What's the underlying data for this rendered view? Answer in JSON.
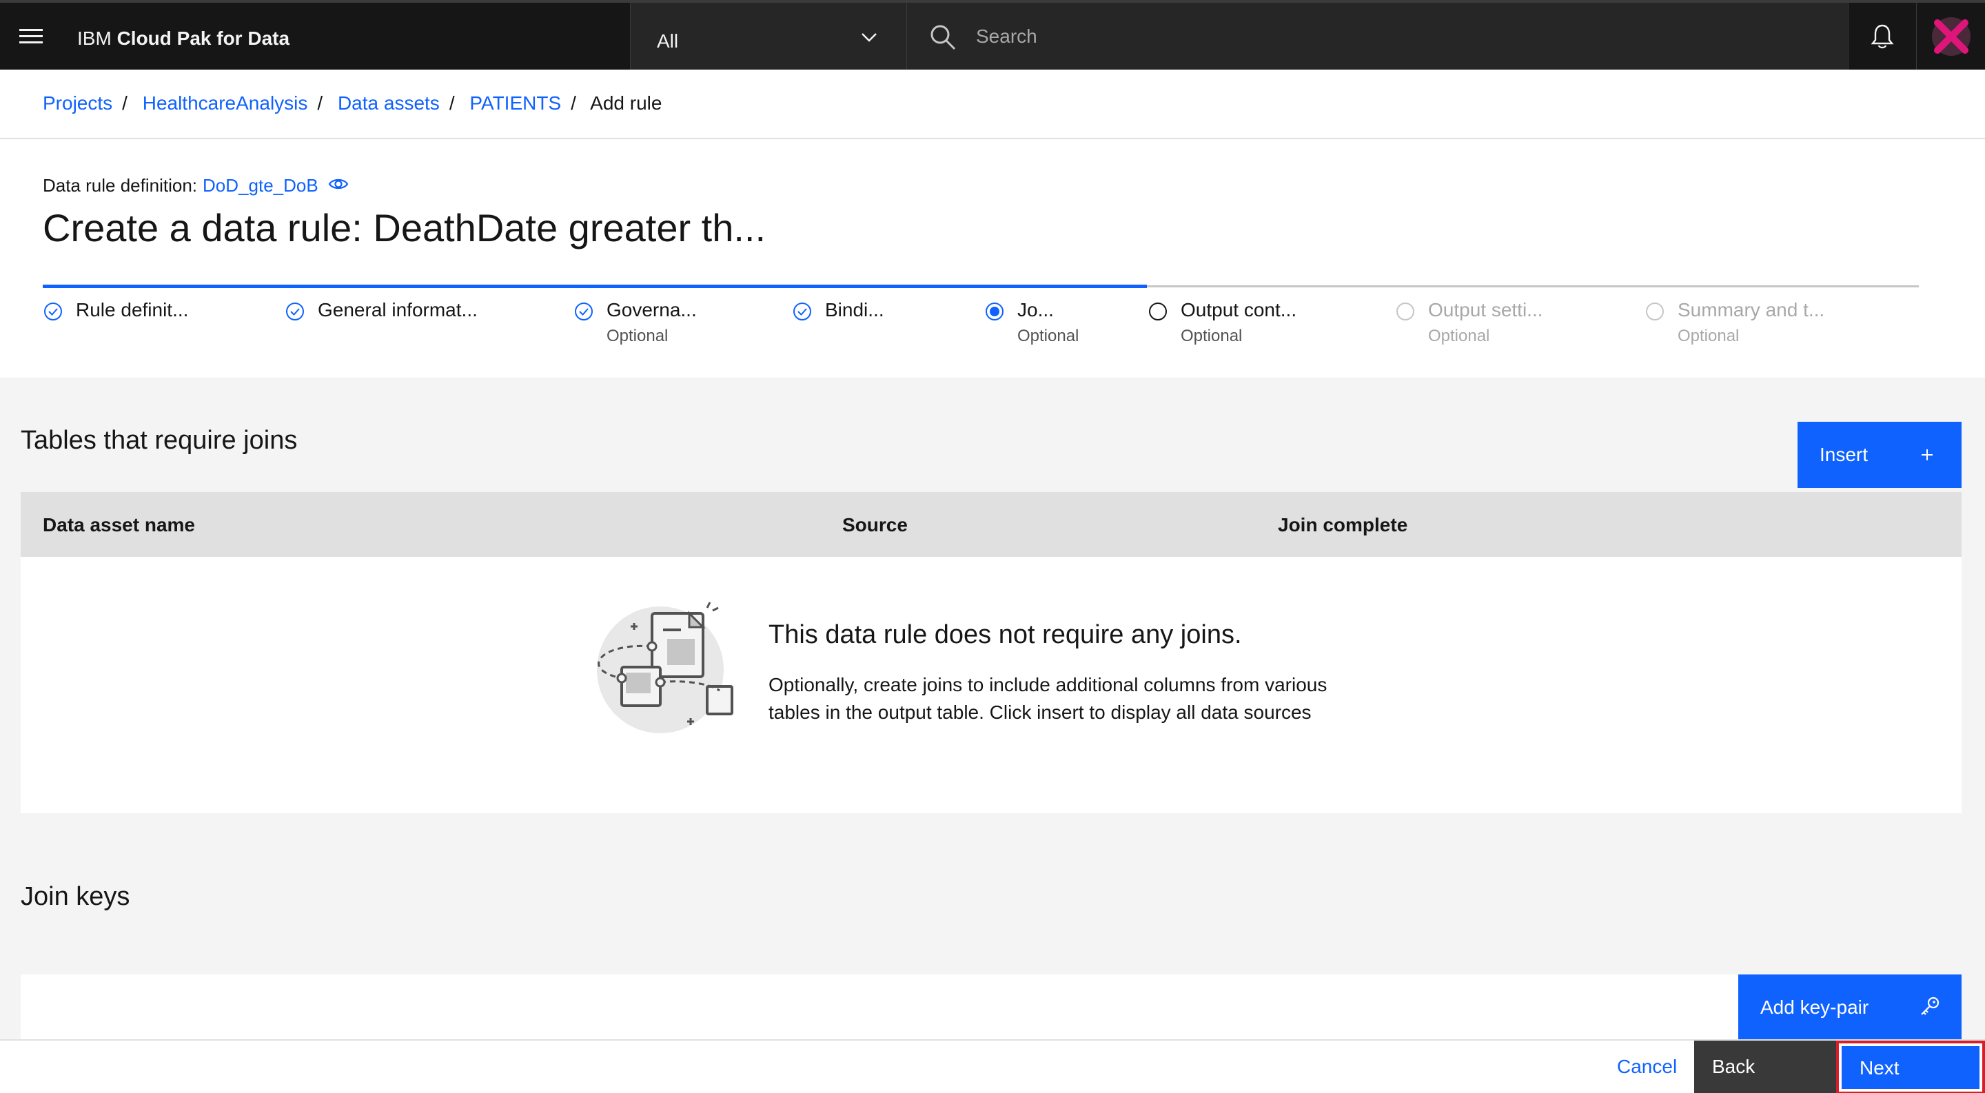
{
  "header": {
    "brand_prefix": "IBM",
    "brand_name": "Cloud Pak for Data",
    "scope_selected": "All",
    "search_placeholder": "Search"
  },
  "breadcrumb": {
    "items": [
      "Projects",
      "HealthcareAnalysis",
      "Data assets",
      "PATIENTS"
    ],
    "current": "Add rule",
    "separator": "/"
  },
  "definition": {
    "label": "Data rule definition:",
    "value": "DoD_gte_DoB"
  },
  "page_title": "Create a data rule: DeathDate greater th...",
  "steps": [
    {
      "label": "Rule definit...",
      "optional": "",
      "state": "complete"
    },
    {
      "label": "General informat...",
      "optional": "",
      "state": "complete"
    },
    {
      "label": "Governa...",
      "optional": "Optional",
      "state": "complete"
    },
    {
      "label": "Bindi...",
      "optional": "",
      "state": "complete"
    },
    {
      "label": "Jo...",
      "optional": "Optional",
      "state": "current"
    },
    {
      "label": "Output cont...",
      "optional": "Optional",
      "state": "incomplete"
    },
    {
      "label": "Output setti...",
      "optional": "Optional",
      "state": "disabled"
    },
    {
      "label": "Summary and t...",
      "optional": "Optional",
      "state": "disabled"
    }
  ],
  "joins": {
    "title": "Tables that require joins",
    "insert_label": "Insert",
    "columns": [
      "Data asset name",
      "Source",
      "Join complete"
    ],
    "empty_title": "This data rule does not require any joins.",
    "empty_desc": "Optionally, create joins to include additional columns from various tables in the output table. Click insert to display all data sources"
  },
  "join_keys": {
    "title": "Join keys",
    "add_label": "Add key-pair"
  },
  "footer": {
    "cancel": "Cancel",
    "back": "Back",
    "next": "Next"
  },
  "colors": {
    "primary": "#0f62fe",
    "header_bg": "#161616",
    "highlight": "#da1e28",
    "avatar_x": "#e0157a"
  }
}
